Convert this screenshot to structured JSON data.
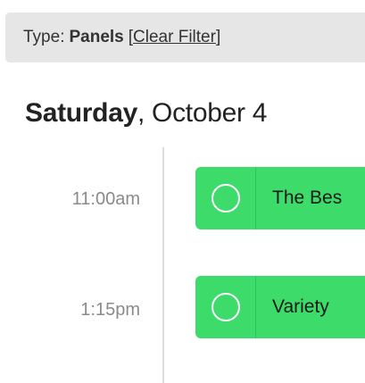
{
  "filter": {
    "type_label": "Type:",
    "type_value": "Panels",
    "open_bracket": "[",
    "clear_label": "Clear Filter",
    "close_bracket": "]"
  },
  "day": {
    "weekday": "Saturday",
    "rest": ", October 4"
  },
  "events": [
    {
      "time": "11:00am",
      "title": "The Bes"
    },
    {
      "time": "1:15pm",
      "title": "Variety"
    }
  ],
  "colors": {
    "event_green": "#3ddc6a",
    "filter_bg": "#e6e6e6"
  }
}
